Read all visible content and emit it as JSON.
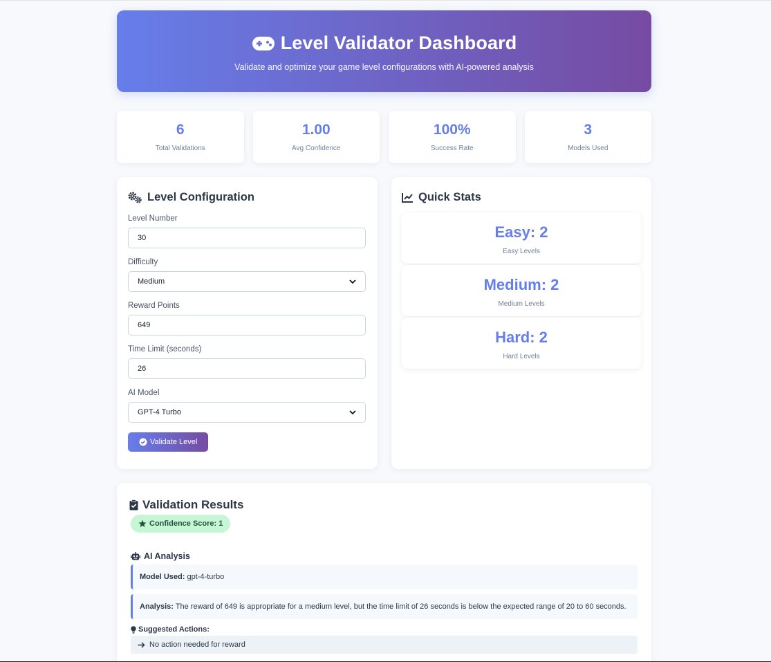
{
  "header": {
    "title": "Level Validator Dashboard",
    "subtitle": "Validate and optimize your game level configurations with AI-powered analysis"
  },
  "stats": [
    {
      "value": "6",
      "label": "Total Validations"
    },
    {
      "value": "1.00",
      "label": "Avg Confidence"
    },
    {
      "value": "100%",
      "label": "Success Rate"
    },
    {
      "value": "3",
      "label": "Models Used"
    }
  ],
  "config": {
    "title": "Level Configuration",
    "level_number_label": "Level Number",
    "level_number_value": "30",
    "difficulty_label": "Difficulty",
    "difficulty_value": "Medium",
    "reward_label": "Reward Points",
    "reward_value": "649",
    "time_label": "Time Limit (seconds)",
    "time_value": "26",
    "model_label": "AI Model",
    "model_value": "GPT-4 Turbo",
    "validate_button": "Validate Level"
  },
  "quick_stats": {
    "title": "Quick Stats",
    "items": [
      {
        "value": "Easy: 2",
        "label": "Easy Levels"
      },
      {
        "value": "Medium: 2",
        "label": "Medium Levels"
      },
      {
        "value": "Hard: 2",
        "label": "Hard Levels"
      }
    ]
  },
  "results": {
    "title": "Validation Results",
    "confidence_badge": "Confidence Score: 1",
    "ai_analysis_title": "AI Analysis",
    "model_used_label": "Model Used:",
    "model_used_value": "gpt-4-turbo",
    "analysis_label": "Analysis:",
    "analysis_text": "The reward of 649 is appropriate for a medium level, but the time limit of 26 seconds is below the expected range of 20 to 60 seconds.",
    "suggested_title": "Suggested Actions:",
    "suggestions": [
      "No action needed for reward"
    ]
  },
  "colors": {
    "accent": "#667eea",
    "gradient_end": "#764ba2",
    "badge_bg": "#c6f6d5",
    "badge_text": "#22543d"
  },
  "icons": {
    "header": "gamepad-icon",
    "config": "cogs-icon",
    "quick_stats": "chart-line-icon",
    "validate": "check-circle-icon",
    "results": "clipboard-check-icon",
    "badge": "star-icon",
    "ai": "robot-icon",
    "suggest": "lightbulb-icon",
    "arrow": "arrow-right-icon"
  }
}
